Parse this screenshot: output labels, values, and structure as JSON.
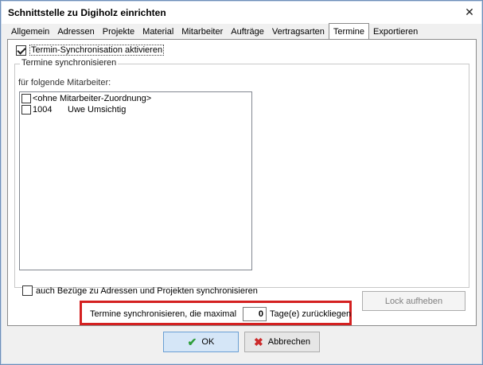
{
  "window": {
    "title": "Schnittstelle zu Digiholz einrichten",
    "close_symbol": "✕"
  },
  "tabs": [
    {
      "label": "Allgemein"
    },
    {
      "label": "Adressen"
    },
    {
      "label": "Projekte"
    },
    {
      "label": "Material"
    },
    {
      "label": "Mitarbeiter"
    },
    {
      "label": "Aufträge"
    },
    {
      "label": "Vertragsarten"
    },
    {
      "label": "Termine",
      "active": true
    },
    {
      "label": "Exportieren"
    }
  ],
  "termine": {
    "sync_enabled_label": "Termin-Synchronisation aktivieren",
    "sync_enabled": true,
    "group_title": "Termine synchronisieren",
    "employees_label": "für folgende Mitarbeiter:",
    "employees": [
      {
        "code": "",
        "name": "<ohne Mitarbeiter-Zuordnung>",
        "checked": false
      },
      {
        "code": "1004",
        "name": "Uwe Umsichtig",
        "checked": false
      }
    ],
    "also_sync_label": "auch Bezüge zu Adressen und Projekten synchronisieren",
    "also_sync": false,
    "days_prefix": "Termine synchronisieren, die maximal",
    "days_value": "0",
    "days_suffix": "Tage(e) zurückliegen",
    "lock_button_label": "Lock aufheben"
  },
  "footer": {
    "ok_label": "OK",
    "cancel_label": "Abbrechen",
    "ok_icon": "checkmark-icon",
    "cancel_icon": "x-icon"
  },
  "colors": {
    "highlight": "#d42020",
    "ok_check": "#2e9e3a",
    "cancel_x": "#cc2a2a"
  }
}
